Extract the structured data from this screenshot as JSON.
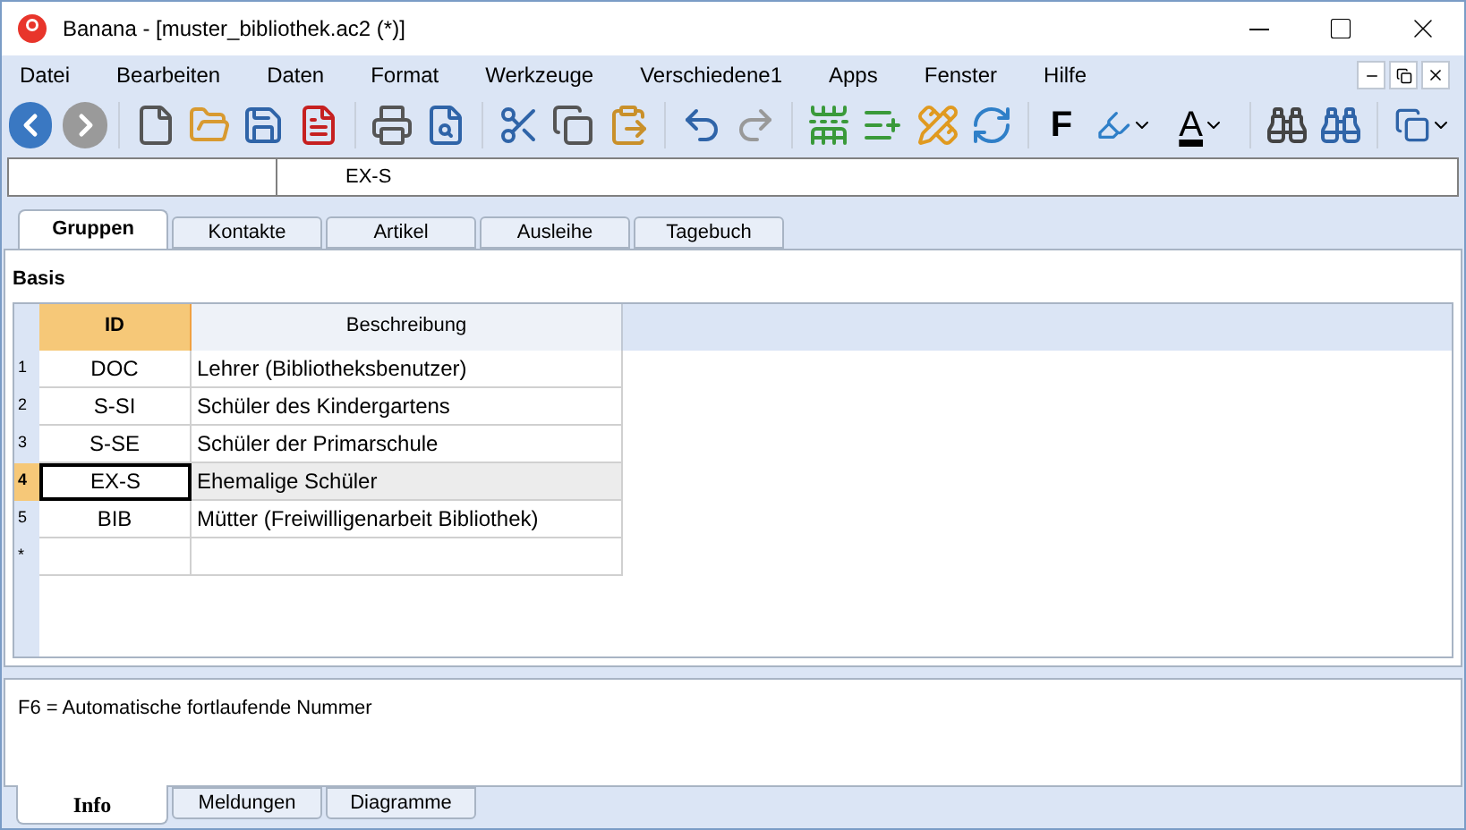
{
  "window": {
    "title": "Banana - [muster_bibliothek.ac2 (*)]"
  },
  "menu": [
    "Datei",
    "Bearbeiten",
    "Daten",
    "Format",
    "Werkzeuge",
    "Verschiedene1",
    "Apps",
    "Fenster",
    "Hilfe"
  ],
  "toolbar": {
    "bold_label": "F",
    "font_color_label": "A"
  },
  "cell_bar": {
    "content": "EX-S"
  },
  "tabs": [
    {
      "label": "Gruppen",
      "selected": true
    },
    {
      "label": "Kontakte",
      "selected": false
    },
    {
      "label": "Artikel",
      "selected": false
    },
    {
      "label": "Ausleihe",
      "selected": false
    },
    {
      "label": "Tagebuch",
      "selected": false
    }
  ],
  "view_label": "Basis",
  "table": {
    "columns": [
      {
        "label": "ID",
        "selected": true
      },
      {
        "label": "Beschreibung",
        "selected": false
      }
    ],
    "rows": [
      {
        "number": "1",
        "id": "DOC",
        "description": "Lehrer (Bibliotheksbenutzer)",
        "selected": false
      },
      {
        "number": "2",
        "id": "S-SI",
        "description": "Schüler des Kindergartens",
        "selected": false
      },
      {
        "number": "3",
        "id": "S-SE",
        "description": "Schüler der Primarschule",
        "selected": false
      },
      {
        "number": "4",
        "id": "EX-S",
        "description": "Ehemalige Schüler",
        "selected": true
      },
      {
        "number": "5",
        "id": "BIB",
        "description": "Mütter (Freiwilligenarbeit Bibliothek)",
        "selected": false
      },
      {
        "number": "*",
        "id": "",
        "description": "",
        "selected": false
      }
    ]
  },
  "info": {
    "text": "F6 = Automatische fortlaufende Nummer"
  },
  "bottom_tabs": [
    {
      "label": "Info",
      "selected": true
    },
    {
      "label": "Meldungen",
      "selected": false
    },
    {
      "label": "Diagramme",
      "selected": false
    }
  ]
}
